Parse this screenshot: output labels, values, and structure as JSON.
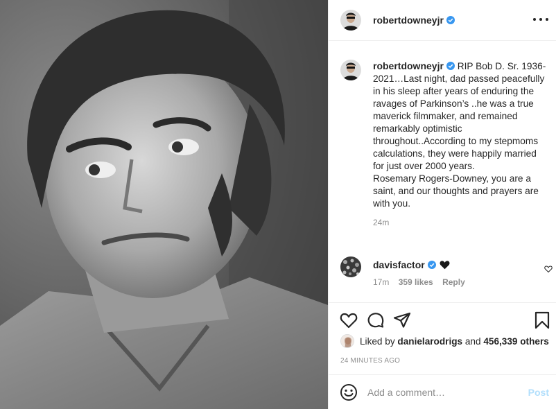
{
  "post": {
    "photo_alt": "black-and-white-portrait",
    "header": {
      "username": "robertdowneyjr",
      "verified_icon": "verified-badge-icon",
      "more_icon": "more-options-icon"
    },
    "caption": {
      "username": "robertdowneyjr",
      "text": "RIP Bob D. Sr. 1936-2021…Last night, dad passed peacefully in his sleep after years of enduring the ravages of Parkinson’s ..he was a true maverick filmmaker, and remained remarkably optimistic throughout..According to my stepmoms calculations, they were happily married for just over 2000 years.\nRosemary Rogers-Downey, you are a saint, and our thoughts and prayers are with you.",
      "time": "24m"
    },
    "comments": [
      {
        "username": "davisfactor",
        "emoji": "black-heart",
        "time": "17m",
        "likes": "359 likes",
        "reply_label": "Reply"
      }
    ],
    "actions": {
      "like_icon": "heart-outline-icon",
      "comment_icon": "comment-bubble-icon",
      "share_icon": "send-paper-plane-icon",
      "save_icon": "bookmark-icon"
    },
    "likes_summary": {
      "prefix": "Liked by ",
      "user": "danielarodrigs",
      "middle": " and ",
      "count": "456,339 others"
    },
    "age": "24 MINUTES AGO",
    "add_comment": {
      "placeholder": "Add a comment…",
      "post_label": "Post"
    },
    "colors": {
      "text": "#262626",
      "muted": "#8e8e8e",
      "verified": "#3897f0",
      "post_disabled": "#b2dffc",
      "border": "#efefef"
    }
  }
}
